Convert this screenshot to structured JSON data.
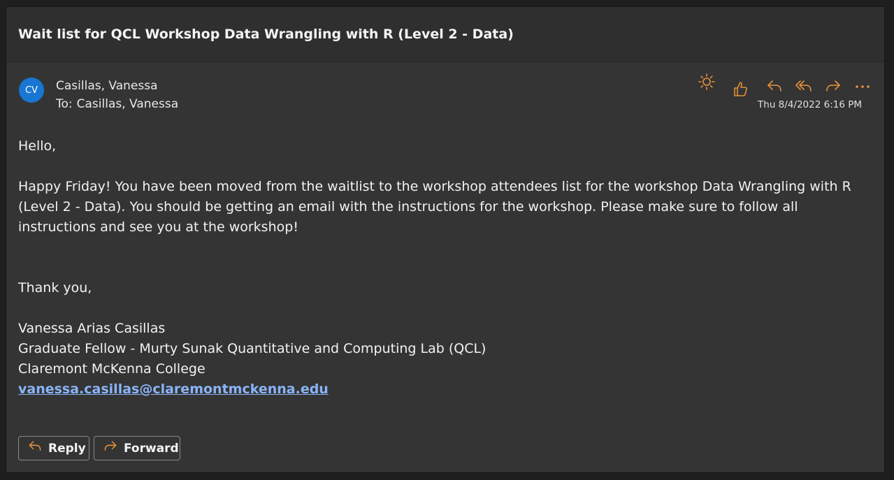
{
  "message": {
    "subject": "Wait list for QCL Workshop Data Wrangling with R (Level 2 - Data)",
    "avatar_initials": "CV",
    "sender": "Casillas, Vanessa",
    "to_label": "To:",
    "recipient": "Casillas, Vanessa",
    "date": "Thu 8/4/2022 6:16 PM"
  },
  "actions": {
    "icons": [
      "sun-icon",
      "like-icon",
      "reply-icon",
      "reply-all-icon",
      "forward-icon",
      "more-icon"
    ]
  },
  "body": {
    "greeting": "Hello,",
    "paragraph": "Happy Friday! You have been moved from the waitlist to the workshop attendees list for the workshop Data Wrangling with R (Level 2 - Data). You should be getting an email with the instructions for the workshop. Please make sure to follow all instructions and see you at the workshop!",
    "closing": "Thank you,",
    "signature": {
      "name": "Vanessa Arias Casillas",
      "title": "Graduate Fellow - Murty Sunak Quantitative and Computing Lab (QCL)",
      "org": "Claremont McKenna College",
      "email": "vanessa.casillas@claremontmckenna.edu"
    }
  },
  "buttons": {
    "reply_label": "Reply",
    "forward_label": "Forward"
  },
  "colors": {
    "accent_icon": "#e8913a",
    "avatar": "#1976d2",
    "link": "#8ab4f8",
    "background": "#343434"
  }
}
